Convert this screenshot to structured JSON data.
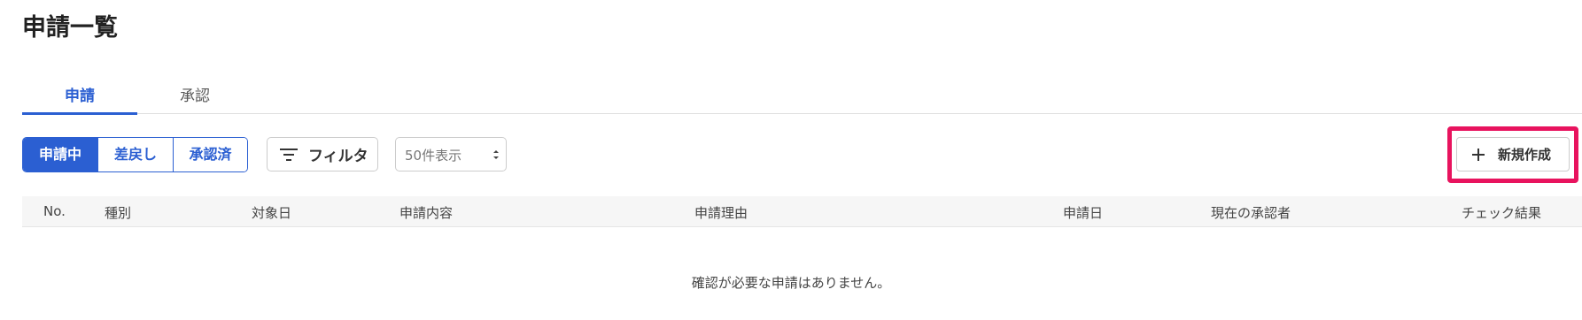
{
  "page": {
    "title": "申請一覧"
  },
  "tabs": [
    {
      "label": "申請",
      "active": true
    },
    {
      "label": "承認",
      "active": false
    }
  ],
  "status_filter": {
    "options": [
      {
        "label": "申請中",
        "active": true
      },
      {
        "label": "差戻し",
        "active": false
      },
      {
        "label": "承認済",
        "active": false
      }
    ]
  },
  "filter_button": {
    "label": "フィルタ",
    "icon": "filter-icon"
  },
  "page_size_select": {
    "selected": "50件表示"
  },
  "new_button": {
    "label": "新規作成",
    "icon": "plus-icon",
    "highlight_color": "#e8135e"
  },
  "table": {
    "columns": [
      "No.",
      "種別",
      "対象日",
      "申請内容",
      "申請理由",
      "申請日",
      "現在の承認者",
      "チェック結果"
    ],
    "rows": [],
    "empty_message": "確認が必要な申請はありません。"
  },
  "colors": {
    "accent": "#2b5fd2",
    "header_bg": "#f6f6f6"
  }
}
